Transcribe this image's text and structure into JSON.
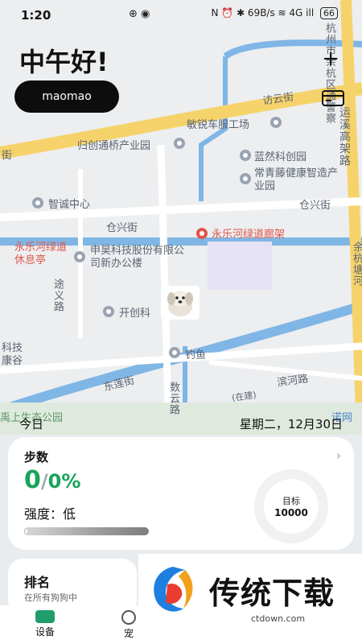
{
  "status": {
    "time": "1:20",
    "left_icons": "⊕ ◉",
    "right_icons": "N ⏰ ✱ 69B/s ≋ 4G ill",
    "battery": "66"
  },
  "header": {
    "greeting": "中午好!",
    "username": "maomao",
    "add_label": "+"
  },
  "map": {
    "labels": {
      "hangzhou": "杭州市余杭区通警察",
      "fangyun": "访云街",
      "minrui": "敏锐车服工场",
      "yunxi": "运溪高架路",
      "jie": "街",
      "guichuang": "归创通桥产业园",
      "lanran": "蓝然科创园",
      "changqingteng": "常青藤健康智造产业园",
      "zhicheng": "智诚中心",
      "cangxing1": "仓兴街",
      "cangxing2": "仓兴街",
      "yongle_red": "永乐河绿道廊架",
      "yongle_rest": "永乐河绿道休息亭",
      "shenhao": "申昊科技股份有限公司新办公楼",
      "tuyi": "途义路",
      "kaichuang": "开创科",
      "kejikang": "科技康谷",
      "diaoyu": "钓鱼",
      "donglian": "东莲街",
      "shuyun": "数云路",
      "zaijian": "(在建)",
      "binhe": "滨河路",
      "yuhang_right": "余杭塘河",
      "zhou": "禹上生态公园",
      "nuo": "诺网"
    }
  },
  "dateline": {
    "today": "今日",
    "date": "星期二，12月30日"
  },
  "steps": {
    "title": "步数",
    "count": "0",
    "separator": "/",
    "percent": "0%",
    "intensity": "强度：低",
    "progress": 0.02,
    "goal_label": "目标",
    "goal_value": "10000"
  },
  "rank": {
    "title": "排名",
    "subtitle": "在所有狗狗中"
  },
  "tabs": [
    {
      "label": "设备"
    },
    {
      "label": "宠"
    }
  ],
  "watermark": {
    "title": "传统下载",
    "url": "ctdown.com"
  },
  "colors": {
    "accent_green": "#19a35b",
    "road_yellow": "#f6d36a",
    "river_blue": "#7fb6e6"
  }
}
